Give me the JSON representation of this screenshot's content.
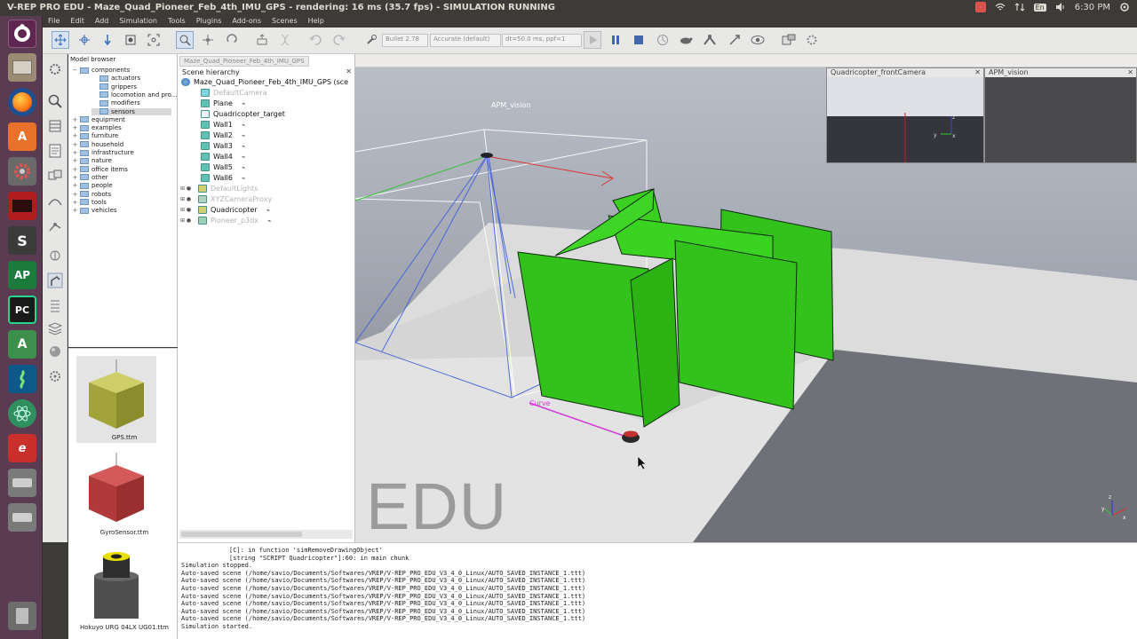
{
  "topbar": {
    "title": "V-REP PRO EDU - Maze_Quad_Pioneer_Feb_4th_IMU_GPS - rendering: 16 ms (35.7 fps) - SIMULATION RUNNING",
    "clock": "6:30 PM",
    "lang": "En"
  },
  "menu": [
    "File",
    "Edit",
    "Add",
    "Simulation",
    "Tools",
    "Plugins",
    "Add-ons",
    "Scenes",
    "Help"
  ],
  "toolbar": {
    "engine": "Bullet 2.78",
    "accuracy": "Accurate (default)",
    "dt": "dt=50.0 ms, ppf=1"
  },
  "model_browser": {
    "title": "Model browser",
    "tree": [
      {
        "label": "components",
        "indent": 0
      },
      {
        "label": "actuators",
        "indent": 1
      },
      {
        "label": "grippers",
        "indent": 1
      },
      {
        "label": "locomotion and pro...",
        "indent": 1
      },
      {
        "label": "modifiers",
        "indent": 1
      },
      {
        "label": "sensors",
        "indent": 1
      },
      {
        "label": "equipment",
        "indent": 0
      },
      {
        "label": "examples",
        "indent": 0
      },
      {
        "label": "furniture",
        "indent": 0
      },
      {
        "label": "household",
        "indent": 0
      },
      {
        "label": "infrastructure",
        "indent": 0
      },
      {
        "label": "nature",
        "indent": 0
      },
      {
        "label": "office items",
        "indent": 0
      },
      {
        "label": "other",
        "indent": 0
      },
      {
        "label": "people",
        "indent": 0
      },
      {
        "label": "robots",
        "indent": 0
      },
      {
        "label": "tools",
        "indent": 0
      },
      {
        "label": "vehicles",
        "indent": 0
      }
    ],
    "thumbs": [
      "GPS.ttm",
      "GyroSensor.ttm",
      "Hokuyo URG 04LX UG01.ttm"
    ]
  },
  "scene_hierarchy": {
    "tab": "Maze_Quad_Pioneer_Feb_4th_IMU_GPS",
    "title": "Scene hierarchy",
    "root": "Maze_Quad_Pioneer_Feb_4th_IMU_GPS (sce",
    "items": [
      {
        "label": "DefaultCamera",
        "dim": true
      },
      {
        "label": "Plane",
        "dim": false
      },
      {
        "label": "Quadricopter_target",
        "dim": false
      },
      {
        "label": "Wall1",
        "dim": false
      },
      {
        "label": "Wall2",
        "dim": false
      },
      {
        "label": "Wall3",
        "dim": false
      },
      {
        "label": "Wall4",
        "dim": false
      },
      {
        "label": "Wall5",
        "dim": false
      },
      {
        "label": "Wall6",
        "dim": false
      },
      {
        "label": "DefaultLights",
        "dim": true
      },
      {
        "label": "XYZCameraProxy",
        "dim": true
      },
      {
        "label": "Quadricopter",
        "dim": false
      },
      {
        "label": "Pioneer_p3dx",
        "dim": true
      }
    ]
  },
  "viewport": {
    "apm_label": "APM_vision",
    "curve_label": "Curve",
    "watermark": "EDU",
    "float_front_title": "Quadricopter_frontCamera",
    "float_apm_title": "APM_vision"
  },
  "console": [
    "[C]: in function 'simRemoveDrawingObject'",
    "[string \"SCRIPT Quadricopter\"]:60: in main chunk",
    "Simulation stopped.",
    "Auto-saved scene (/home/savio/Documents/Softwares/VREP/V-REP_PRO_EDU_V3_4_0_Linux/AUTO_SAVED_INSTANCE_1.ttt)",
    "Auto-saved scene (/home/savio/Documents/Softwares/VREP/V-REP_PRO_EDU_V3_4_0_Linux/AUTO_SAVED_INSTANCE_1.ttt)",
    "Auto-saved scene (/home/savio/Documents/Softwares/VREP/V-REP_PRO_EDU_V3_4_0_Linux/AUTO_SAVED_INSTANCE_1.ttt)",
    "Auto-saved scene (/home/savio/Documents/Softwares/VREP/V-REP_PRO_EDU_V3_4_0_Linux/AUTO_SAVED_INSTANCE_1.ttt)",
    "Auto-saved scene (/home/savio/Documents/Softwares/VREP/V-REP_PRO_EDU_V3_4_0_Linux/AUTO_SAVED_INSTANCE_1.ttt)",
    "Auto-saved scene (/home/savio/Documents/Softwares/VREP/V-REP_PRO_EDU_V3_4_0_Linux/AUTO_SAVED_INSTANCE_1.ttt)",
    "Auto-saved scene (/home/savio/Documents/Softwares/VREP/V-REP_PRO_EDU_V3_4_0_Linux/AUTO_SAVED_INSTANCE_1.ttt)",
    "Simulation started."
  ],
  "colors": {
    "wall_green": "#33c21b",
    "launcher": "#5a3b52",
    "curve_magenta": "#d23bd6"
  }
}
